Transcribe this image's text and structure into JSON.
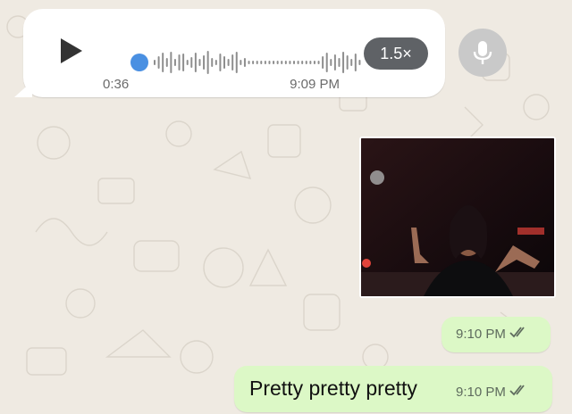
{
  "voice_message": {
    "duration": "0:36",
    "time": "9:09 PM",
    "speed": "1.5×",
    "progress": 0.0
  },
  "messages": [
    {
      "type": "image",
      "alt": "video thumbnail"
    },
    {
      "type": "time_only",
      "time": "9:10 PM",
      "status": "read"
    },
    {
      "type": "text",
      "text": "Pretty pretty pretty",
      "time": "9:10 PM",
      "status": "read"
    }
  ],
  "colors": {
    "wallpaper": "#efeae2",
    "incoming_bubble": "#ffffff",
    "outgoing_bubble": "#dcf8c6",
    "accent_blue": "#4a90e2",
    "speed_badge": "#5f6266",
    "mic_button": "#c9c9c9"
  },
  "icons": {
    "play": "play-icon",
    "mic": "microphone-icon",
    "ticks": "double-check-icon"
  }
}
